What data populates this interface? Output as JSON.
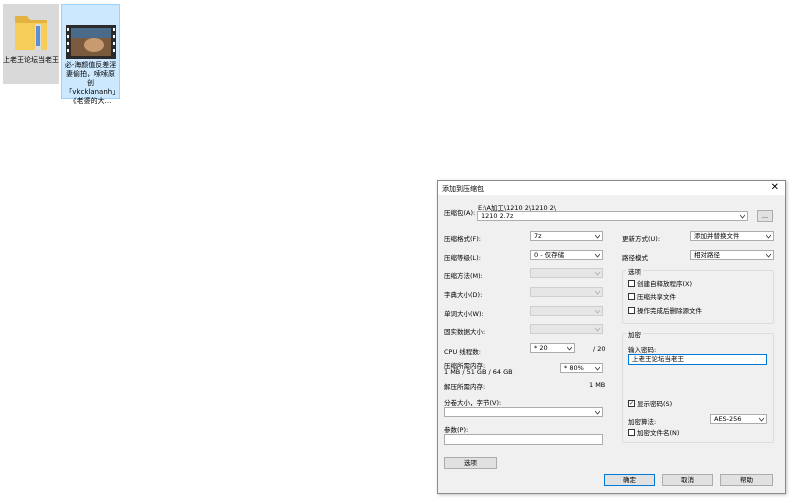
{
  "desktop": {
    "folder_label": "上老王论坛当老王",
    "video_label": "必-海颜值反差淫妻偷拍，嗦嗦原创「vkcklananh」《老婆的大..."
  },
  "dialog": {
    "title": "添加到压缩包",
    "archive_label": "压缩包(A):",
    "archive_path": "E:\\A加工\\1210 2\\1210 2\\",
    "archive_name": "1210 2.7z",
    "browse_label": "...",
    "format_label": "压缩格式(F):",
    "format_value": "7z",
    "level_label": "压缩等级(L):",
    "level_value": "0 - 仅存储",
    "method_label": "压缩方法(M):",
    "dict_label": "字典大小(D):",
    "word_label": "单词大小(W):",
    "solid_label": "固实数据大小:",
    "threads_label": "CPU 线程数:",
    "threads_value": "* 20",
    "threads_max": "/ 20",
    "mem_label": "压缩所需内存:",
    "mem_detail": "1 MB / 51 GB / 64 GB",
    "mem_value": "* 80%",
    "decomp_mem_label": "解压所需内存:",
    "decomp_mem_value": "1 MB",
    "volume_label": "分卷大小，字节(V):",
    "params_label": "参数(P):",
    "options_button": "选项",
    "update_label": "更新方式(U):",
    "update_value": "添加并替换文件",
    "pathmode_label": "路径模式",
    "pathmode_value": "相对路径",
    "options_group": "选项",
    "opt_sfx": "创建自释放程序(X)",
    "opt_shared": "压缩共享文件",
    "opt_delete": "操作完成后删除源文件",
    "encrypt_group": "加密",
    "password_label": "输入密码:",
    "password_value": "上老王论坛当老王",
    "show_password": "显示密码(S)",
    "enc_method_label": "加密算法:",
    "enc_method_value": "AES-256",
    "encrypt_names": "加密文件名(N)",
    "ok": "确定",
    "cancel": "取消",
    "help": "帮助"
  }
}
